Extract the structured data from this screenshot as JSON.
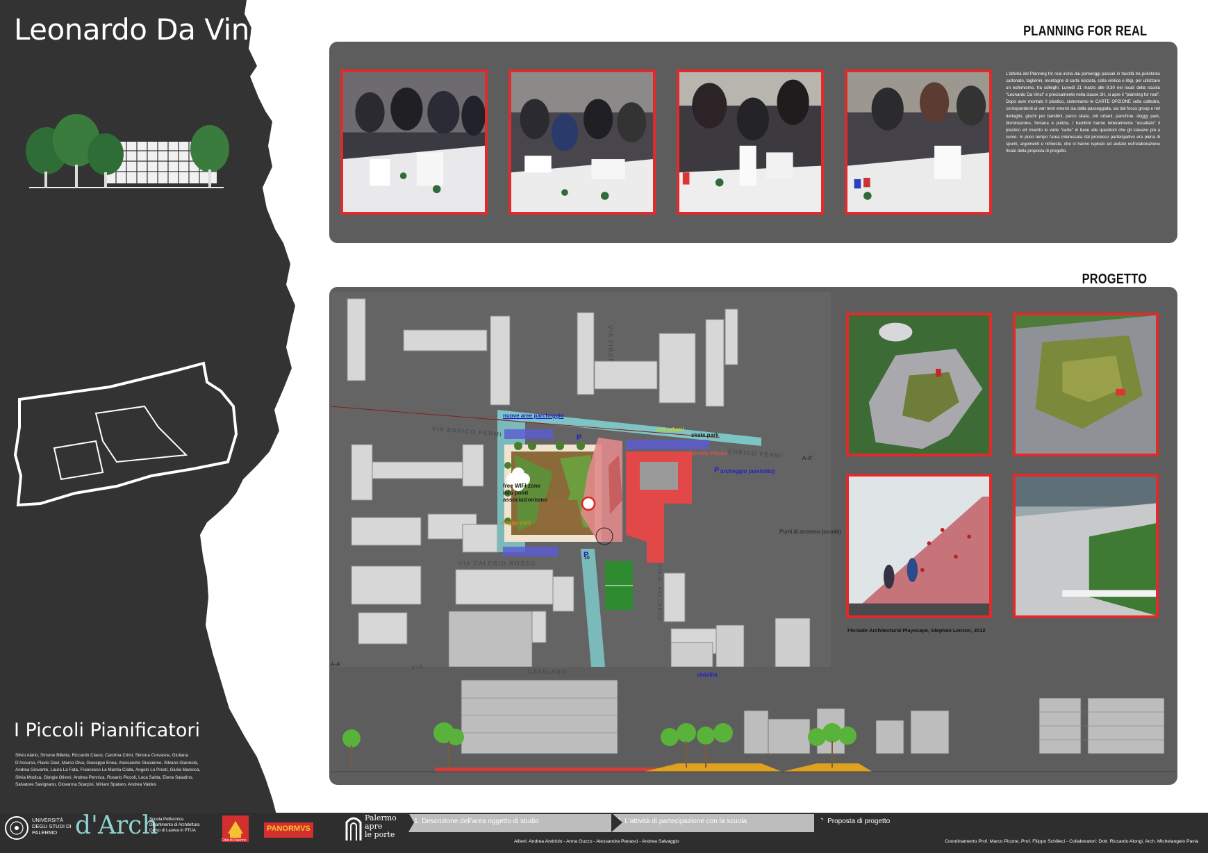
{
  "header": {
    "title": "Leonardo Da Vinci"
  },
  "planning": {
    "heading": "PLANNING FOR REAL",
    "text": "L'attività del Planning for real inizia dai pomeriggi passati in facoltà tra polistirolo cartonato, taglierini, montagne di carta riciclata, colla vinilica e litigi, per utilizzare un eufemismo, tra colleghi. Lunedì 21 marzo alle 9.30 nei locali della scuola \"Leonardo Da Vinci\" e precisamente nella classe 2H, si apre il \"planning for real\". Dopo aver montato il plastico, sistemiamo le CARTE OPZIONE sulla cattedra, corrispondenti ai vari temi emersi sia dalla passeggiata, sia dal focus group e nel dettaglio, giochi per bambini, parco skate, orti urbani, panchine, doggy park, illuminazione, fontana e pulizia. I bambini hanno letteralmente \"assaltato\" il plastico ed inserito le varie \"carte\" in base alle questioni che gli stavano più a cuore. In poco tempo l'area interessata dal processo partecipativo era piena di spunti, argomenti e richieste, che ci hanno ispirato ed aiutato nell'elaborazione finale della proposta di progetto."
  },
  "progetto": {
    "heading": "PROGETTO",
    "caption": "Floriade Architectural Playscape, Stephan Lenzen, 2012"
  },
  "map": {
    "labels": {
      "parking_new": "nuove aree parcheggio",
      "orti": "orti urbani",
      "skate": "skate park",
      "strada": "strada chiusa",
      "parcheggio_assistito_p": "P",
      "parcheggio_assistito": "archeggio (assistito)",
      "wifi1": "free WIFI zone",
      "wifi2": "info point",
      "wifi3": "associazionismo",
      "doggy": "doggy park",
      "punti": "Punti di accesso (scuola)",
      "viabilita": "viabilità",
      "aa_right": "A-A'",
      "aa_left": "A-A'",
      "speed": "10",
      "p1": "P",
      "p2": "P"
    },
    "streets": {
      "enrico_fermi_left": "VIA ENRICO FERMI",
      "enrico_fermi_right": "ENRICO FERMI",
      "calderoni": "VIA CALERIO ROSSO",
      "catalano": "CATALANO",
      "via": "VIA",
      "vert1": "VIA FIRST",
      "vert2": "VIA G. FALCARDO"
    }
  },
  "team": {
    "title": "I Piccoli Pianificatori",
    "names": "Silvio Alario, Simone Billetta, Riccardo Clausi, Carolina Crimi, Simona Corvasce, Giuliana D'Accurso, Flavio Davì, Marco Diva, Giuseppe Enea, Alessandro Giacalone, Silvano Giannola, Andrea Giovante, Laura La Fata, Francesco La Mantia Cialla, Angelo Lo Presti, Giulia Maresca, Silvia Modica, Giorgia Oliveri, Andrea Pennica, Rosario Piccoli, Luca Saitta, Elena Saladino, Salvatore Savignano, Giovanna Scarpisi, Miriam Spataro, Andrea Valdes"
  },
  "footer": {
    "steps": [
      "1.   Descrizione dell'area oggetto di studio",
      "2.  L'attività di partecipazione con la scuola",
      "3.   Proposta di progetto"
    ],
    "students": "Allievi: Andrea Andriolo - Anna Guzzo - Alessandra Panasci - Andrea Salvaggio",
    "coordination": "Coordinamento Prof. Marco Picone, Prof. Filippo Schilleci - Collaboratori: Dott. Riccardo Alongi, Arch. Michelangelo Pavia",
    "logos": {
      "unipa": "UNIVERSITÀ DEGLI STUDI DI PALERMO",
      "darch": "d'Arch",
      "darch_sub1": "Scuola Politecnica",
      "darch_sub2": "Dipartimento di Architettura",
      "darch_sub3": "Corso di Laurea in PTUA",
      "citta": "Città di Palermo",
      "panormus": "PANORMVS",
      "apre1": "Palermo",
      "apre2": "apre",
      "apre3": "le porte"
    }
  },
  "colors": {
    "dark": "#333333",
    "panel": "#5d5d5d",
    "accent_red": "#e12b2b",
    "teal": "#7fcfcf"
  }
}
